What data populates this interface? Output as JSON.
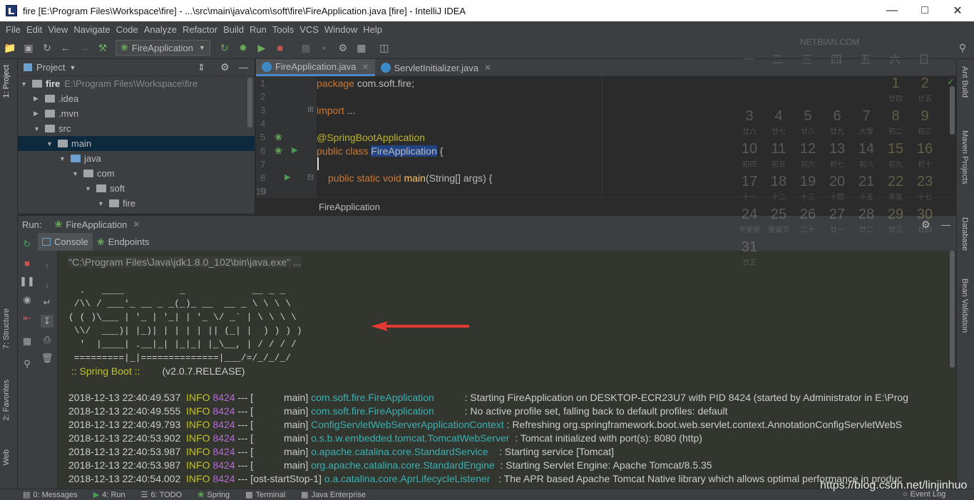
{
  "title": "fire [E:\\Program Files\\Workspace\\fire] - ...\\src\\main\\java\\com\\soft\\fire\\FireApplication.java [fire] - IntelliJ IDEA",
  "menu": [
    "File",
    "Edit",
    "View",
    "Navigate",
    "Code",
    "Analyze",
    "Refactor",
    "Build",
    "Run",
    "Tools",
    "VCS",
    "Window",
    "Help"
  ],
  "toolbar": {
    "run_config": "FireApplication"
  },
  "watermark_top": "NETBIAN.COM",
  "left_tabs": {
    "project": "1: Project",
    "structure": "7: Structure",
    "favorites": "2: Favorites",
    "web": "Web"
  },
  "right_tabs": {
    "ant": "Ant Build",
    "maven": "Maven Projects",
    "database": "Database",
    "bean": "Bean Validation"
  },
  "project": {
    "header": "Project",
    "root": "fire",
    "root_path": "E:\\Program Files\\Workspace\\fire",
    "items": [
      ".idea",
      ".mvn",
      "src",
      "main",
      "java",
      "com",
      "soft",
      "fire"
    ]
  },
  "editor": {
    "tabs": [
      "FireApplication.java",
      "ServletInitializer.java"
    ],
    "line_numbers": [
      "1",
      "2",
      "3",
      "4",
      "5",
      "6",
      "7",
      "8",
      "9",
      "10"
    ],
    "code": {
      "l1_kw": "package",
      "l1_rest": " com.soft.fire;",
      "l3_kw": "import",
      "l3_rest": " ...",
      "l6": "@SpringBootApplication",
      "l7_kw": "public class",
      "l7_name": "FireApplication",
      "l7_rest": " {",
      "l9_kw": "public static void",
      "l9_fn": "main",
      "l9_rest": "(String[] args) {"
    },
    "breadcrumb": "FireApplication"
  },
  "run": {
    "label": "Run:",
    "config": "FireApplication",
    "tabs": [
      "Console",
      "Endpoints"
    ]
  },
  "console": {
    "cmd": "\"C:\\Program Files\\Java\\jdk1.8.0_102\\bin\\java.exe\" ...",
    "banner": [
      "  .   ____          _            __ _ _",
      " /\\\\ / ___'_ __ _ _(_)_ __  __ _ \\ \\ \\ \\",
      "( ( )\\___ | '_ | '_| | '_ \\/ _` | \\ \\ \\ \\",
      " \\\\/  ___)| |_)| | | | | || (_| |  ) ) ) )",
      "  '  |____| .__|_| |_|_| |_\\__, | / / / /",
      " =========|_|==============|___/=/_/_/_/"
    ],
    "spring_label": " :: Spring Boot :: ",
    "spring_version": "       (v2.0.7.RELEASE)",
    "logs": [
      {
        "ts": "2018-12-13 22:40:49.537",
        "lvl": "INFO",
        "pid": "8424",
        "sep": " --- [",
        "thread": "           main]",
        "cls": "com.soft.fire.FireApplication",
        "pad": "           ",
        "msg": ": Starting FireApplication on DESKTOP-ECR23U7 with PID 8424 (started by Administrator in E:\\Prog"
      },
      {
        "ts": "2018-12-13 22:40:49.555",
        "lvl": "INFO",
        "pid": "8424",
        "sep": " --- [",
        "thread": "           main]",
        "cls": "com.soft.fire.FireApplication",
        "pad": "           ",
        "msg": ": No active profile set, falling back to default profiles: default"
      },
      {
        "ts": "2018-12-13 22:40:49.793",
        "lvl": "INFO",
        "pid": "8424",
        "sep": " --- [",
        "thread": "           main]",
        "cls": "ConfigServletWebServerApplicationContext",
        "pad": " ",
        "msg": ": Refreshing org.springframework.boot.web.servlet.context.AnnotationConfigServletWebS"
      },
      {
        "ts": "2018-12-13 22:40:53.902",
        "lvl": "INFO",
        "pid": "8424",
        "sep": " --- [",
        "thread": "           main]",
        "cls": "o.s.b.w.embedded.tomcat.TomcatWebServer",
        "pad": "  ",
        "msg": ": Tomcat initialized with port(s): 8080 (http)"
      },
      {
        "ts": "2018-12-13 22:40:53.987",
        "lvl": "INFO",
        "pid": "8424",
        "sep": " --- [",
        "thread": "           main]",
        "cls": "o.apache.catalina.core.StandardService",
        "pad": "    ",
        "msg": ": Starting service [Tomcat]"
      },
      {
        "ts": "2018-12-13 22:40:53.987",
        "lvl": "INFO",
        "pid": "8424",
        "sep": " --- [",
        "thread": "           main]",
        "cls": "org.apache.catalina.core.StandardEngine",
        "pad": "  ",
        "msg": ": Starting Servlet Engine: Apache Tomcat/8.5.35"
      },
      {
        "ts": "2018-12-13 22:40:54.002",
        "lvl": "INFO",
        "pid": "8424",
        "sep": " --- [",
        "thread": "ost-startStop-1]",
        "cls": "o.a.catalina.core.AprLifecycleListener",
        "pad": "   ",
        "msg": ": The APR based Apache Tomcat Native library which allows optimal performance in produc"
      }
    ]
  },
  "calendar": {
    "weekdays": [
      "一",
      "二",
      "三",
      "四",
      "五",
      "六",
      "日"
    ],
    "rows": [
      [
        {
          "n": "",
          "s": ""
        },
        {
          "n": "",
          "s": ""
        },
        {
          "n": "",
          "s": ""
        },
        {
          "n": "",
          "s": ""
        },
        {
          "n": "",
          "s": ""
        },
        {
          "n": "1",
          "s": "廿四"
        },
        {
          "n": "2",
          "s": "廿五"
        }
      ],
      [
        {
          "n": "3",
          "s": "廿六"
        },
        {
          "n": "4",
          "s": "廿七"
        },
        {
          "n": "5",
          "s": "廿八"
        },
        {
          "n": "6",
          "s": "廿九"
        },
        {
          "n": "7",
          "s": "大雪"
        },
        {
          "n": "8",
          "s": "初二"
        },
        {
          "n": "9",
          "s": "初三"
        }
      ],
      [
        {
          "n": "10",
          "s": "初四"
        },
        {
          "n": "11",
          "s": "初五"
        },
        {
          "n": "12",
          "s": "初六"
        },
        {
          "n": "13",
          "s": "初七"
        },
        {
          "n": "14",
          "s": "初八"
        },
        {
          "n": "15",
          "s": "初九"
        },
        {
          "n": "16",
          "s": "初十"
        }
      ],
      [
        {
          "n": "17",
          "s": "十一"
        },
        {
          "n": "18",
          "s": "十二"
        },
        {
          "n": "19",
          "s": "十三"
        },
        {
          "n": "20",
          "s": "十四"
        },
        {
          "n": "21",
          "s": "十五"
        },
        {
          "n": "22",
          "s": "冬至"
        },
        {
          "n": "23",
          "s": "十七"
        }
      ],
      [
        {
          "n": "24",
          "s": "平安夜"
        },
        {
          "n": "25",
          "s": "圣诞节"
        },
        {
          "n": "26",
          "s": "二十"
        },
        {
          "n": "27",
          "s": "廿一"
        },
        {
          "n": "28",
          "s": "廿二"
        },
        {
          "n": "29",
          "s": "廿三"
        },
        {
          "n": "30",
          "s": "廿四"
        }
      ],
      [
        {
          "n": "31",
          "s": "廿五"
        },
        {
          "n": "",
          "s": ""
        },
        {
          "n": "",
          "s": ""
        },
        {
          "n": "",
          "s": ""
        },
        {
          "n": "",
          "s": ""
        },
        {
          "n": "",
          "s": ""
        },
        {
          "n": "",
          "s": ""
        }
      ]
    ]
  },
  "status": {
    "items": [
      "0: Messages",
      "4: Run",
      "6: TODO",
      "Spring",
      "Terminal",
      "Java Enterprise"
    ],
    "event_log": "Event Log",
    "blog_watermark": "https://blog.csdn.net/linjinhuo"
  },
  "colors": {
    "arrow": "#e53935",
    "accent": "#4a88c7"
  }
}
